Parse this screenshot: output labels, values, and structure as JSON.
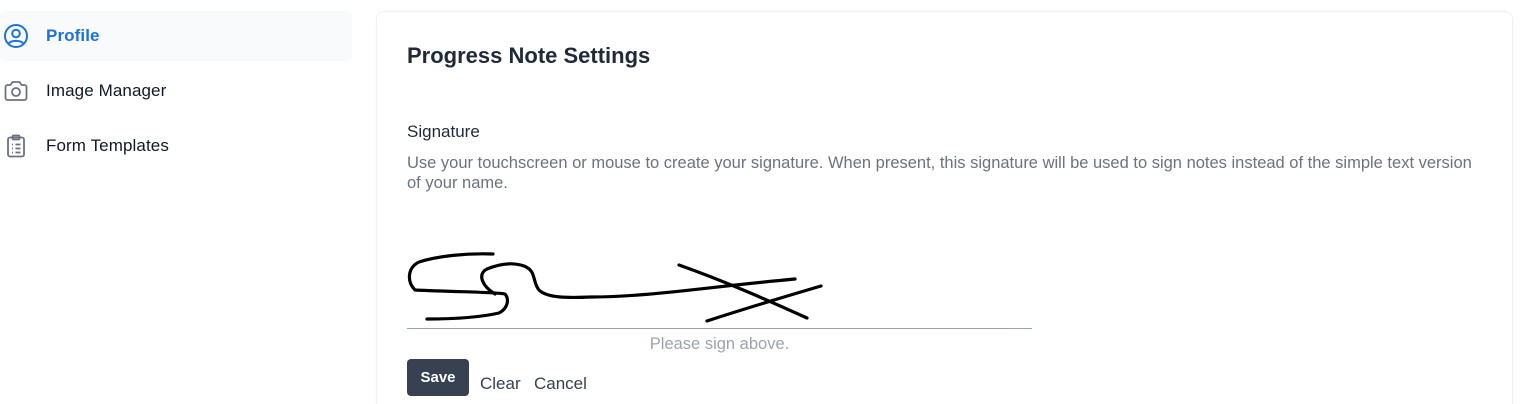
{
  "sidebar": {
    "items": [
      {
        "label": "Profile",
        "icon": "user-circle-icon",
        "active": true
      },
      {
        "label": "Image Manager",
        "icon": "camera-icon",
        "active": false
      },
      {
        "label": "Form Templates",
        "icon": "clipboard-list-icon",
        "active": false
      }
    ]
  },
  "main": {
    "title": "Progress Note Settings",
    "signature": {
      "heading": "Signature",
      "description": "Use your touchscreen or mouse to create your signature. When present, this signature will be used to sign notes instead of the simple text version of your name.",
      "hint": "Please sign above.",
      "save_label": "Save",
      "clear_label": "Clear",
      "cancel_label": "Cancel"
    }
  },
  "colors": {
    "accent": "#1a73d9",
    "save_button_bg": "#374151",
    "muted_text": "#6b7280",
    "hint_text": "#9ca3af"
  }
}
